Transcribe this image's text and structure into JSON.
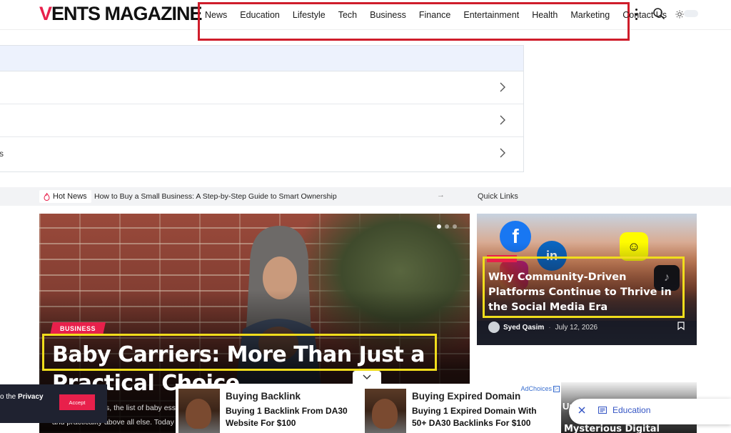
{
  "header": {
    "logo_first": "V",
    "logo_rest": "ENTS MAGAZINE",
    "nav": [
      "News",
      "Education",
      "Lifestyle",
      "Tech",
      "Business",
      "Finance",
      "Entertainment",
      "Health",
      "Marketing",
      "Contact Us"
    ]
  },
  "panel": {
    "rows": [
      "",
      "",
      "s"
    ]
  },
  "ticker": {
    "badge": "Hot News",
    "headline": "How to Buy a Small Business: A Step-by-Step Guide to Smart Ownership",
    "arrow": "→",
    "quick_links": "Quick Links"
  },
  "featured": {
    "category": "BUSINESS",
    "title": "Baby Carriers: More Than Just a Practical Choice",
    "excerpt_line1": "s, the list of baby esse",
    "excerpt_line2": "and practicality above all else. Today"
  },
  "side_post": {
    "title": "Why Community-Driven Platforms Continue to Thrive in the Social Media Era",
    "author": "Syed Qasim",
    "date": "July 12, 2026"
  },
  "teaser": {
    "line1": "Ur",
    "line2": "Mysterious Digital"
  },
  "cookie": {
    "text_prefix": "o the ",
    "link": "Privacy",
    "accept": "Accept"
  },
  "ads": [
    {
      "headline": "Buying Backlink",
      "desc_line1": "Buying 1 Backlink From DA30",
      "desc_line2": "Website For $100"
    },
    {
      "headline": "Buying Expired Domain",
      "desc_line1": "Buying 1 Expired Domain With",
      "desc_line2": "50+ DA30 Backlinks For $100",
      "adchoices": "AdChoices"
    }
  ],
  "toast": {
    "label": "Education"
  },
  "colors": {
    "brand": "#e8204b",
    "highlight_yellow": "#f0dd1c",
    "nav_outline": "#cf1d2b"
  }
}
